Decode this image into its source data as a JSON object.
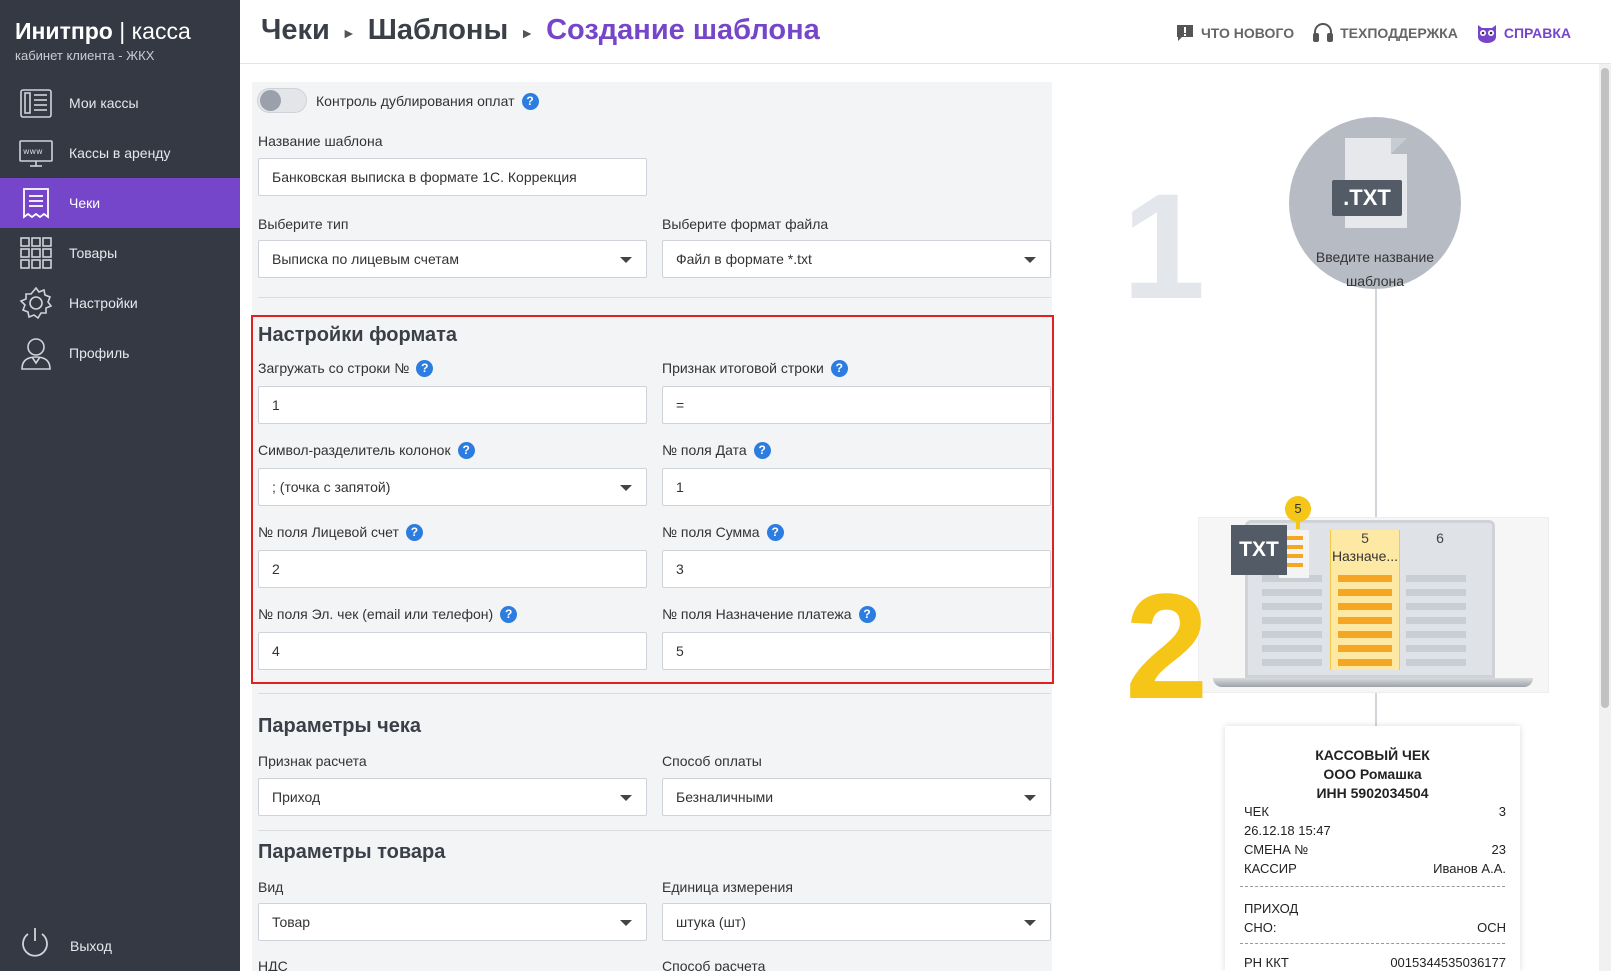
{
  "brand": {
    "name_bold": "Инитпро",
    "name_sep": " | ",
    "name_thin": "касса",
    "subtitle": "кабинет клиента - ЖКХ"
  },
  "sidebar": {
    "items": [
      {
        "label": "Мои кассы",
        "icon": "cash-register-icon"
      },
      {
        "label": "Кассы в аренду",
        "icon": "www-monitor-icon"
      },
      {
        "label": "Чеки",
        "icon": "receipt-icon"
      },
      {
        "label": "Товары",
        "icon": "grid-icon"
      },
      {
        "label": "Настройки",
        "icon": "gear-icon"
      },
      {
        "label": "Профиль",
        "icon": "user-icon"
      }
    ],
    "active": "Чеки",
    "logout": {
      "label": "Выход",
      "icon": "power-icon"
    }
  },
  "header": {
    "breadcrumbs": [
      "Чеки",
      "Шаблоны",
      "Создание шаблона"
    ],
    "links": [
      {
        "label": "ЧТО НОВОГО",
        "icon": "news-icon"
      },
      {
        "label": "ТЕХПОДДЕРЖКА",
        "icon": "headset-icon"
      },
      {
        "label": "СПРАВКА",
        "icon": "owl-icon"
      }
    ]
  },
  "form": {
    "toggle": {
      "label": "Контроль дублирования оплат",
      "on": false
    },
    "template_name": {
      "label": "Название шаблона",
      "value": "Банковская выписка в формате 1С. Коррекция"
    },
    "type": {
      "label": "Выберите тип",
      "value": "Выписка по лицевым счетам"
    },
    "file_format": {
      "label": "Выберите формат файла",
      "value": "Файл в формате *.txt"
    },
    "format_settings": {
      "title": "Настройки формата",
      "start_row": {
        "label": "Загружать со строки №",
        "value": "1"
      },
      "total_marker": {
        "label": "Признак итоговой строки",
        "value": "="
      },
      "delimiter": {
        "label": "Символ-разделитель колонок",
        "value": "; (точка с запятой)"
      },
      "date_field": {
        "label": "№ поля Дата",
        "value": "1"
      },
      "account_field": {
        "label": "№ поля Лицевой счет",
        "value": "2"
      },
      "sum_field": {
        "label": "№ поля Сумма",
        "value": "3"
      },
      "echeck_field": {
        "label": "№ поля Эл. чек (email или телефон)",
        "value": "4"
      },
      "purpose_field": {
        "label": "№ поля Назначение платежа",
        "value": "5"
      }
    },
    "check_params": {
      "title": "Параметры чека",
      "calc_sign": {
        "label": "Признак расчета",
        "value": "Приход"
      },
      "payment_method": {
        "label": "Способ оплаты",
        "value": "Безналичными"
      }
    },
    "product_params": {
      "title": "Параметры товара",
      "kind": {
        "label": "Вид",
        "value": "Товар"
      },
      "unit": {
        "label": "Единица измерения",
        "value": "штука (шт)"
      },
      "vat_label": "НДС",
      "calc_method_label": "Способ расчета"
    }
  },
  "illustration": {
    "step1": "1",
    "step2": "2",
    "file_tag": ".TXT",
    "circle_text": [
      "Введите название",
      "шаблона"
    ],
    "table": {
      "col5": "5",
      "col6": "6",
      "cell": "Назначе..."
    },
    "badge": "TXT",
    "pin": "5",
    "receipt": {
      "title": "КАССОВЫЙ ЧЕК",
      "org": "ООО Ромашка",
      "inn": "ИНН 5902034504",
      "rows": [
        {
          "left": "ЧЕК",
          "right": "3"
        },
        {
          "left": "26.12.18 15:47",
          "right": ""
        },
        {
          "left": "СМЕНА №",
          "right": "23"
        },
        {
          "left": "КАССИР",
          "right": "Иванов А.А."
        }
      ],
      "rows2": [
        {
          "left": "ПРИХОД",
          "right": ""
        },
        {
          "left": "СНО:",
          "right": "ОСН"
        }
      ],
      "last": {
        "left": "РН ККТ",
        "right": "0015344535036177"
      }
    }
  },
  "colors": {
    "sidebar": "#343944",
    "accent": "#7546c9",
    "help_blue": "#2d7de0",
    "highlight_red": "#e32020",
    "step_yellow": "#f5c518"
  }
}
